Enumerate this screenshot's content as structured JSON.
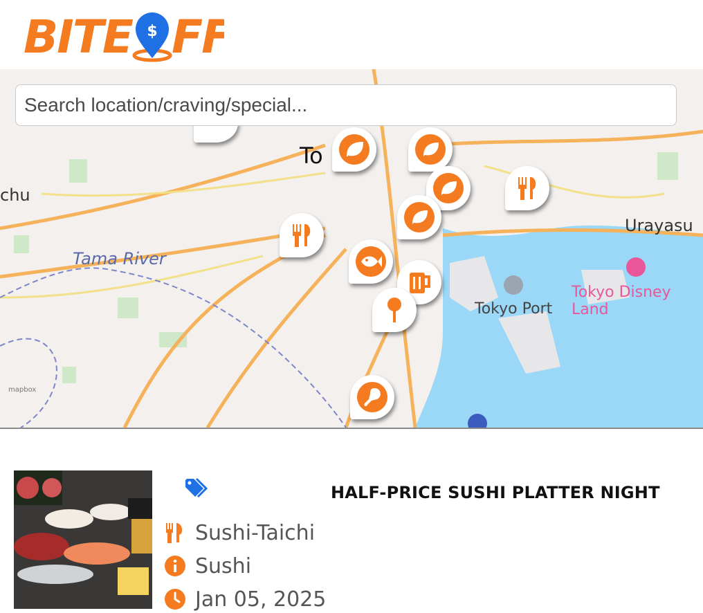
{
  "header": {
    "logo_text_left": "BITE",
    "logo_text_right": "FF",
    "logo_pin_symbol": "$"
  },
  "map": {
    "search": {
      "placeholder": "Search location/craving/special...",
      "value": ""
    },
    "labels": {
      "city_partial": "To",
      "west": "chu",
      "river": "Tama River",
      "urayasu": "Urayasu",
      "port": "Tokyo Port",
      "disney": "Tokyo Disney Land",
      "attribution": "mapbox"
    },
    "marker_icons": [
      "leaf-icon",
      "fork-knife-icon",
      "fish-icon",
      "beer-mug-icon",
      "chicken-leg-icon",
      "lollipop-icon"
    ]
  },
  "card": {
    "title": "HALF-PRICE SUSHI PLATTER NIGHT",
    "restaurant": "Sushi-Taichi",
    "category": "Sushi",
    "date": "Jan 05, 2025"
  },
  "colors": {
    "brand": "#f47b20",
    "tag_blue": "#1f6fe5",
    "water": "#9bd7f7",
    "land": "#f3f0ee"
  }
}
